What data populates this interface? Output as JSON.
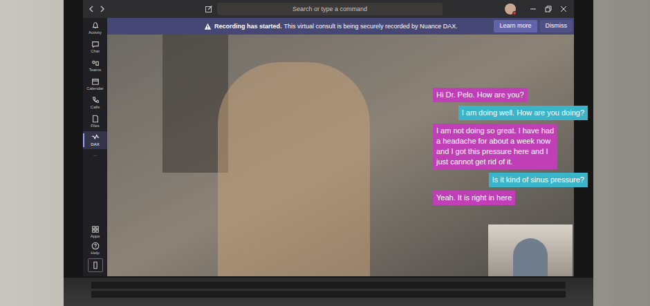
{
  "titlebar": {
    "search": {
      "placeholder": "Search or type a command"
    }
  },
  "rail": {
    "items": [
      {
        "label": "Activity",
        "selected": false
      },
      {
        "label": "Chat",
        "selected": false
      },
      {
        "label": "Teams",
        "selected": false
      },
      {
        "label": "Calendar",
        "selected": false
      },
      {
        "label": "Calls",
        "selected": false
      },
      {
        "label": "Files",
        "selected": false
      },
      {
        "label": "DAX",
        "selected": true
      },
      {
        "label": "...",
        "selected": false
      }
    ],
    "bottom_items": [
      {
        "label": "Apps"
      },
      {
        "label": "Help"
      }
    ]
  },
  "banner": {
    "title": "Recording has started.",
    "text": "This virtual consult is being securely recorded by Nuance DAX.",
    "buttons": [
      "Learn more",
      "Dismiss"
    ]
  },
  "messages": [
    {
      "text": "Hi Dr. Pelo. How are you?",
      "kind": "patient",
      "color": "#c03fb6"
    },
    {
      "text": "I am doing well. How are you doing?",
      "kind": "doctor",
      "color": "#3ab4c8"
    },
    {
      "text": "I am not doing so great. I have had a headache for about a week now and I got this pressure here and I just cannot get rid of it.",
      "kind": "patient",
      "color": "#c03fb6"
    },
    {
      "text": "Is it kind of sinus pressure?",
      "kind": "doctor",
      "color": "#3ab4c8"
    },
    {
      "text": "Yeah. It is right in here",
      "kind": "patient",
      "color": "#c03fb6"
    }
  ]
}
